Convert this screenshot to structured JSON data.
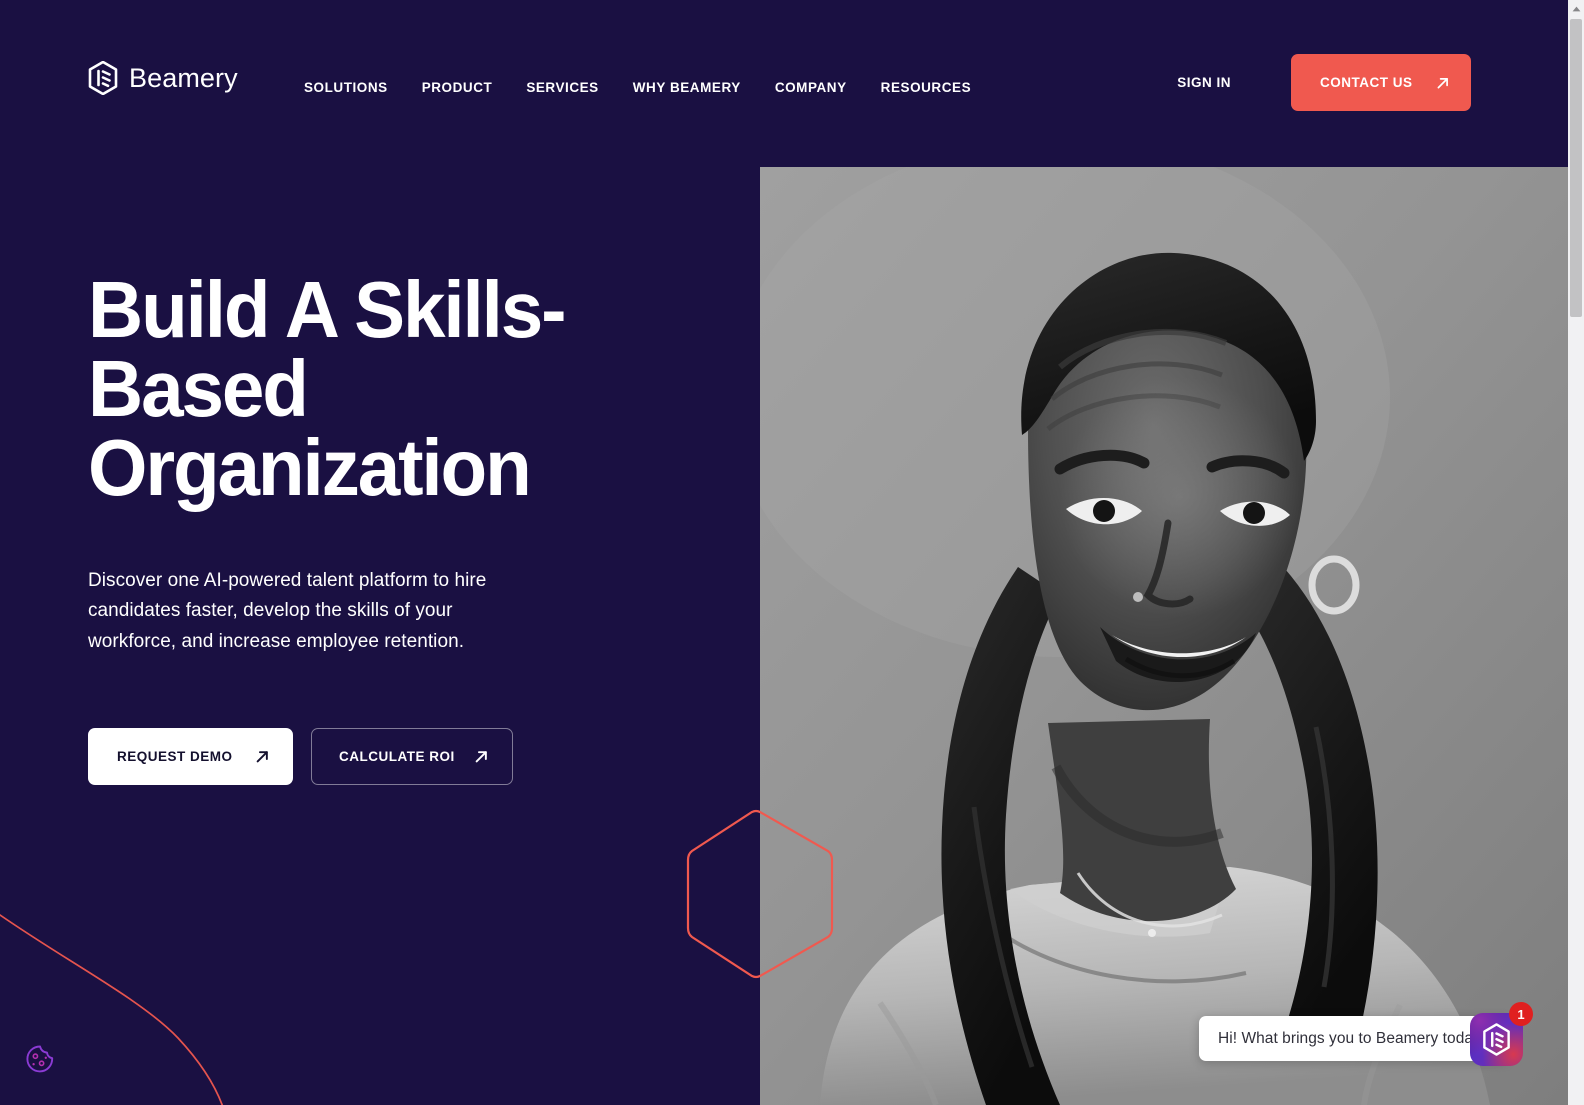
{
  "theme": {
    "navy": "#1a1042",
    "coral": "#f0594f",
    "white": "#ffffff",
    "badge_red": "#e02020",
    "cookie_purple": "#8b3bd4",
    "photo_gray": "#919191"
  },
  "nav": {
    "brand": {
      "name": "Beamery",
      "logo_icon": "beamery-hexagon-logo-icon"
    },
    "links": [
      {
        "label": "SOLUTIONS"
      },
      {
        "label": "PRODUCT"
      },
      {
        "label": "SERVICES"
      },
      {
        "label": "WHY BEAMERY"
      },
      {
        "label": "COMPANY"
      },
      {
        "label": "RESOURCES"
      }
    ],
    "sign_in_label": "SIGN IN",
    "contact": {
      "label": "CONTACT US",
      "icon": "arrow-up-right-icon",
      "bg": "#f0594f"
    }
  },
  "hero": {
    "title": "Build A Skills-Based\nOrganization",
    "subtitle": "Discover one AI-powered talent platform to hire candidates faster, develop the skills of your workforce, and increase employee retention.",
    "buttons": [
      {
        "label": "REQUEST DEMO",
        "icon": "arrow-up-right-icon",
        "style": "solid-white"
      },
      {
        "label": "CALCULATE ROI",
        "icon": "arrow-up-right-icon",
        "style": "outline"
      }
    ],
    "photo_alt": "Smiling woman with braided hair, black and white portrait",
    "decorations": [
      {
        "name": "hexagon-outline",
        "color": "#f0594f"
      },
      {
        "name": "curved-line",
        "color": "#f0594f"
      }
    ]
  },
  "chat": {
    "message": "Hi! What brings you to Beamery today?",
    "launcher_icon": "beamery-hexagon-logo-icon",
    "unread_count": "1"
  },
  "cookie": {
    "icon": "cookie-icon",
    "label": "Cookie preferences"
  },
  "scrollbar": {
    "up_arrow_icon": "scroll-up-arrow-icon",
    "position": "top"
  }
}
